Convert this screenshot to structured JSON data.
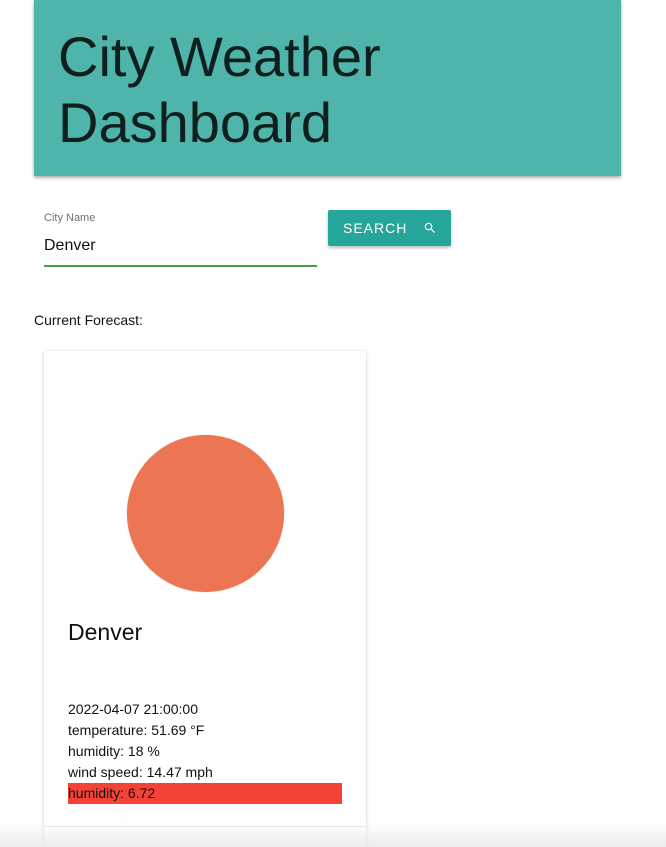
{
  "header": {
    "title": "City Weather Dashboard",
    "background_color": "#4fb5ab"
  },
  "search": {
    "label": "City Name",
    "value": "Denver",
    "underline_color": "#43a047",
    "button_label": "SEARCH",
    "button_icon": "search-icon",
    "button_color": "#26a69a"
  },
  "forecast": {
    "heading": "Current Forecast:",
    "card": {
      "icon": "sun-circle-icon",
      "icon_color": "#ec7653",
      "city": "Denver",
      "datetime": "2022-04-07 21:00:00",
      "temperature": "temperature: 51.69 °F",
      "humidity": "humidity: 18 %",
      "wind_speed": "wind speed: 14.47 mph",
      "alert": "humidity: 6.72",
      "alert_color": "#f44336"
    }
  }
}
